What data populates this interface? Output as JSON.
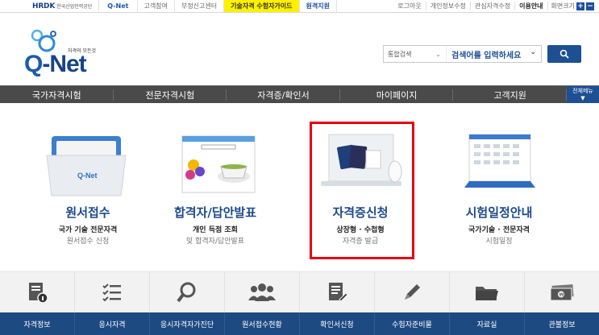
{
  "topbar": {
    "hrdk_logo": "HRDK",
    "hrdk_sub": "한국산업인력공단",
    "qnet_mini": "Q-Net",
    "links": [
      "고객참여",
      "부정신고센터",
      "기술자격 수험자가이드",
      "원격지원"
    ],
    "right_links": [
      "로그아웃",
      "개인정보수정",
      "관심자격수정",
      "이용안내"
    ],
    "zoom_label": "화면크기",
    "zoom_in": "+",
    "zoom_out": "−"
  },
  "header": {
    "logo_tagline": "자격의 모든것",
    "logo_q": "Q",
    "logo_word": "-Net",
    "search_scope": "통합검색",
    "search_placeholder": "검색어를 입력하세요"
  },
  "nav": {
    "items": [
      "국가자격시험",
      "전문자격시험",
      "자격증/확인서",
      "마이페이지",
      "고객지원"
    ],
    "all_menu": "전체메뉴"
  },
  "tiles": [
    {
      "title": "원서접수",
      "sub1": "국가 기술 전문자격",
      "sub2": "원서접수 신청"
    },
    {
      "title": "합격자/답안발표",
      "sub1": "개인 득점 조회",
      "sub2": "및 합격자/답안발표"
    },
    {
      "title": "자격증신청",
      "sub1": "상장형 · 수첩형",
      "sub2": "자격증 발급"
    },
    {
      "title": "시험일정안내",
      "sub1": "국가기술 · 전문자격",
      "sub2": "시험일정"
    }
  ],
  "quick": [
    {
      "label": "자격정보",
      "icon": "document-info-icon"
    },
    {
      "label": "응시자격",
      "icon": "checklist-icon"
    },
    {
      "label": "응시자격자가진단",
      "icon": "magnifier-icon"
    },
    {
      "label": "원서접수현황",
      "icon": "people-icon"
    },
    {
      "label": "확인서신청",
      "icon": "document-pen-icon"
    },
    {
      "label": "수험자준비물",
      "icon": "pencil-icon"
    },
    {
      "label": "자료실",
      "icon": "folder-icon"
    },
    {
      "label": "관불정보",
      "icon": "money-icon"
    }
  ],
  "colors": {
    "brand_blue": "#1c4a8c",
    "nav_dark": "#4a4a4a",
    "label_bar": "#1e4a82",
    "highlight": "#e60012"
  }
}
